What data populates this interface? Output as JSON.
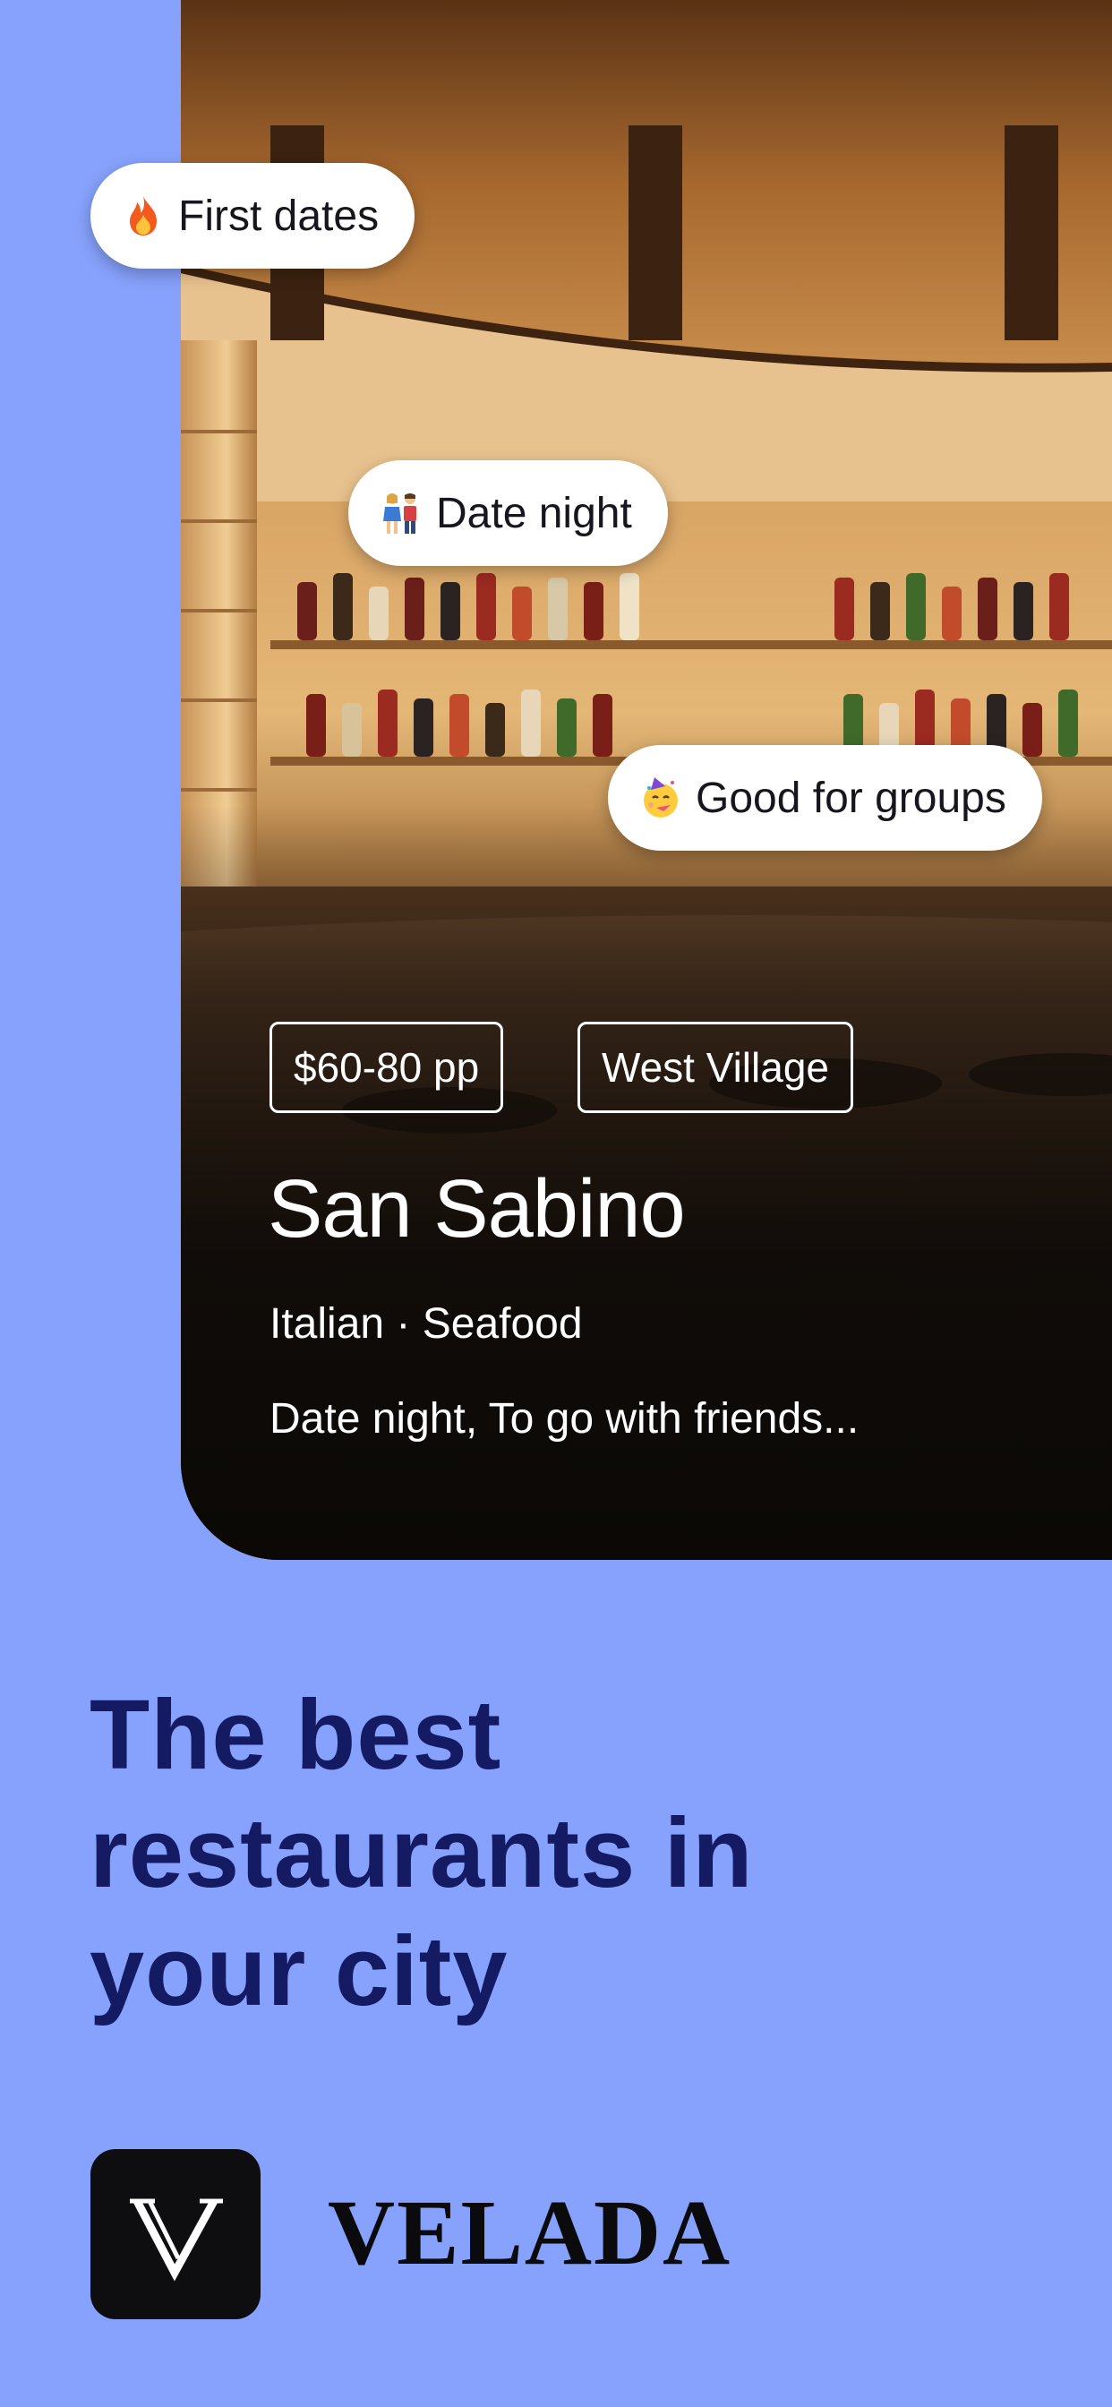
{
  "colors": {
    "background": "#87a2fc",
    "headline": "#141b63",
    "card_overlay": "#0f0b08",
    "pill_bg": "#ffffff",
    "logo_bg": "#0e0e10"
  },
  "pills": [
    {
      "icon": "fire-icon",
      "label": "First dates"
    },
    {
      "icon": "couple-icon",
      "label": "Date night"
    },
    {
      "icon": "party-face-icon",
      "label": "Good for groups"
    }
  ],
  "restaurant": {
    "price": "$60-80 pp",
    "neighborhood": "West Village",
    "name": "San Sabino",
    "cuisine": "Italian · Seafood",
    "description": "Date night, To go with friends..."
  },
  "headline": {
    "lines": [
      "The best",
      "restaurants in",
      "your city"
    ]
  },
  "brand": {
    "logo_letter": "V",
    "name": "VELADA"
  }
}
